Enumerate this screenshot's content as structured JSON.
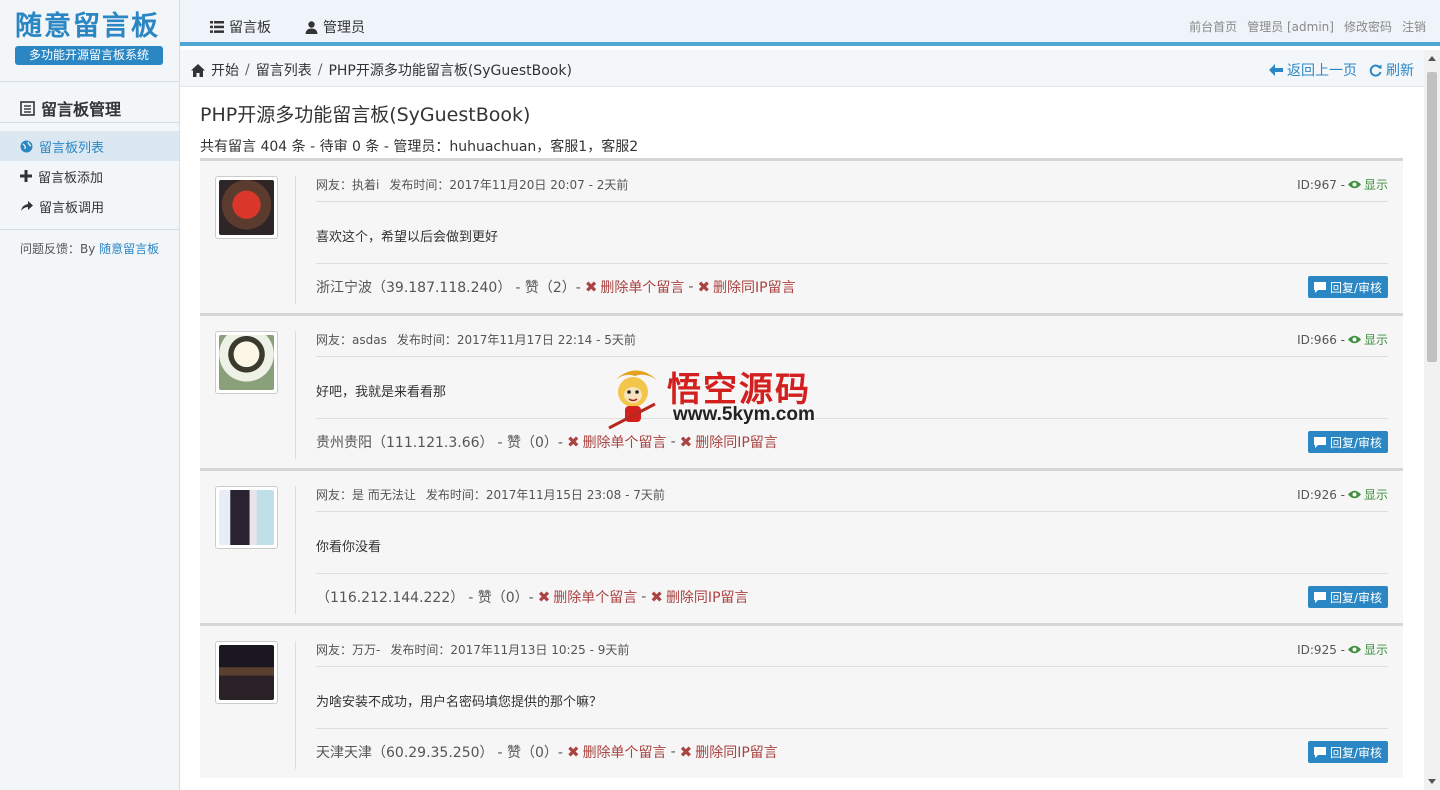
{
  "logo": {
    "title": "随意留言板",
    "subtitle": "多功能开源留言板系统"
  },
  "sidebar": {
    "header": "留言板管理",
    "items": [
      {
        "label": "留言板列表",
        "icon": "globe-icon"
      },
      {
        "label": "留言板添加",
        "icon": "plus-icon"
      },
      {
        "label": "留言板调用",
        "icon": "share-icon"
      }
    ],
    "feedback_label": "问题反馈：By",
    "feedback_link": "随意留言板"
  },
  "topnav": {
    "guestbook": "留言板",
    "admin": "管理员"
  },
  "toplinks": {
    "home": "前台首页",
    "user": "管理员 [admin]",
    "password": "修改密码",
    "logout": "注销"
  },
  "breadcrumb": {
    "start": "开始",
    "list": "留言列表",
    "current": "PHP开源多功能留言板(SyGuestBook)",
    "back": "返回上一页",
    "refresh": "刷新"
  },
  "main": {
    "title": "PHP开源多功能留言板(SyGuestBook)",
    "summary": "共有留言 404 条 - 待审 0 条 - 管理员：huhuachuan，客服1，客服2"
  },
  "messages": [
    {
      "user": "网友：执着i",
      "time": "发布时间：2017年11月20日 20:07 - 2天前",
      "id": "ID:967 -",
      "show": "显示",
      "text": "喜欢这个，希望以后会做到更好",
      "location": "浙江宁波（39.187.118.240）",
      "likes": "- 赞（2）-",
      "del_one": "删除单个留言",
      "sep": "-",
      "del_ip": "删除同IP留言",
      "reply": "回复/审核"
    },
    {
      "user": "网友：asdas",
      "time": "发布时间：2017年11月17日 22:14 - 5天前",
      "id": "ID:966 -",
      "show": "显示",
      "text": "好吧，我就是来看看那",
      "location": "贵州贵阳（111.121.3.66）",
      "likes": "- 赞（0）-",
      "del_one": "删除单个留言",
      "sep": "-",
      "del_ip": "删除同IP留言",
      "reply": "回复/审核"
    },
    {
      "user": "网友：是 而无法让",
      "time": "发布时间：2017年11月15日 23:08 - 7天前",
      "id": "ID:926 -",
      "show": "显示",
      "text": "你看你没看",
      "location": "（116.212.144.222）",
      "likes": "- 赞（0）-",
      "del_one": "删除单个留言",
      "sep": "-",
      "del_ip": "删除同IP留言",
      "reply": "回复/审核"
    },
    {
      "user": "网友：万万-",
      "time": "发布时间：2017年11月13日 10:25 - 9天前",
      "id": "ID:925 -",
      "show": "显示",
      "text": "为啥安装不成功，用户名密码填您提供的那个嘛？",
      "location": "天津天津（60.29.35.250）",
      "likes": "- 赞（0）-",
      "del_one": "删除单个留言",
      "sep": "-",
      "del_ip": "删除同IP留言",
      "reply": "回复/审核"
    }
  ],
  "watermark": {
    "title": "悟空源码",
    "url": "www.5kym.com"
  },
  "colors": {
    "accent": "#2b87c4",
    "delete": "#a94442",
    "show": "#3e8f3e"
  }
}
